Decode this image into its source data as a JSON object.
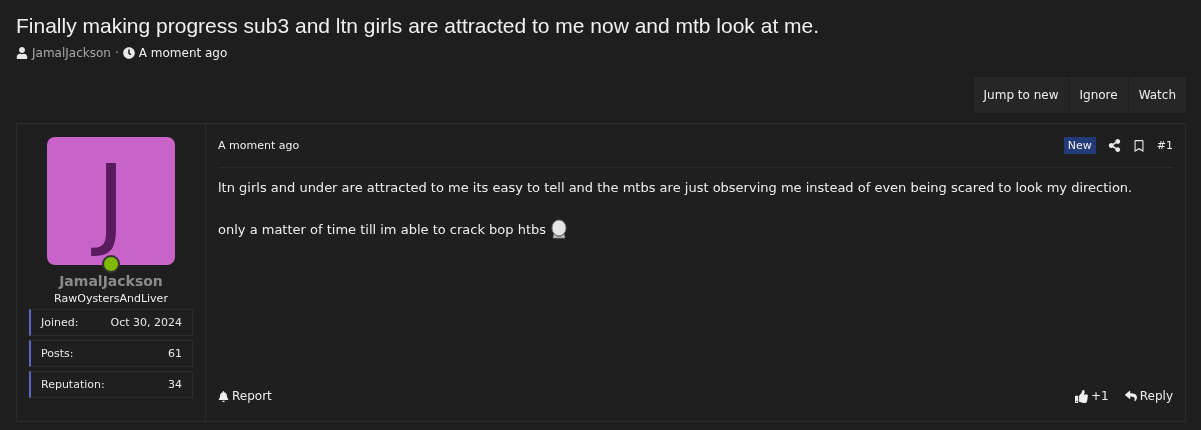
{
  "thread": {
    "title": "Finally making progress sub3 and ltn girls are attracted to me now and mtb look at me.",
    "author": "JamalJackson",
    "separator": "·",
    "time": "A moment ago"
  },
  "actions": [
    "Jump to new",
    "Ignore",
    "Watch"
  ],
  "post": {
    "user": {
      "initial": "J",
      "online": true,
      "name": "JamalJackson",
      "title": "RawOystersAndLiver",
      "stats": [
        {
          "label": "Joined:",
          "value": "Oct 30, 2024"
        },
        {
          "label": "Posts:",
          "value": "61"
        },
        {
          "label": "Reputation:",
          "value": "34"
        }
      ]
    },
    "time": "A moment ago",
    "badge": "New",
    "number": "#1",
    "paragraphs": [
      "ltn girls and under are attracted to me its easy to tell and the mtbs are just observing me instead of even being scared to look my direction.",
      "only a matter of time till im able to crack bop htbs"
    ],
    "report": "Report",
    "likes": "+1",
    "reply": "Reply"
  }
}
